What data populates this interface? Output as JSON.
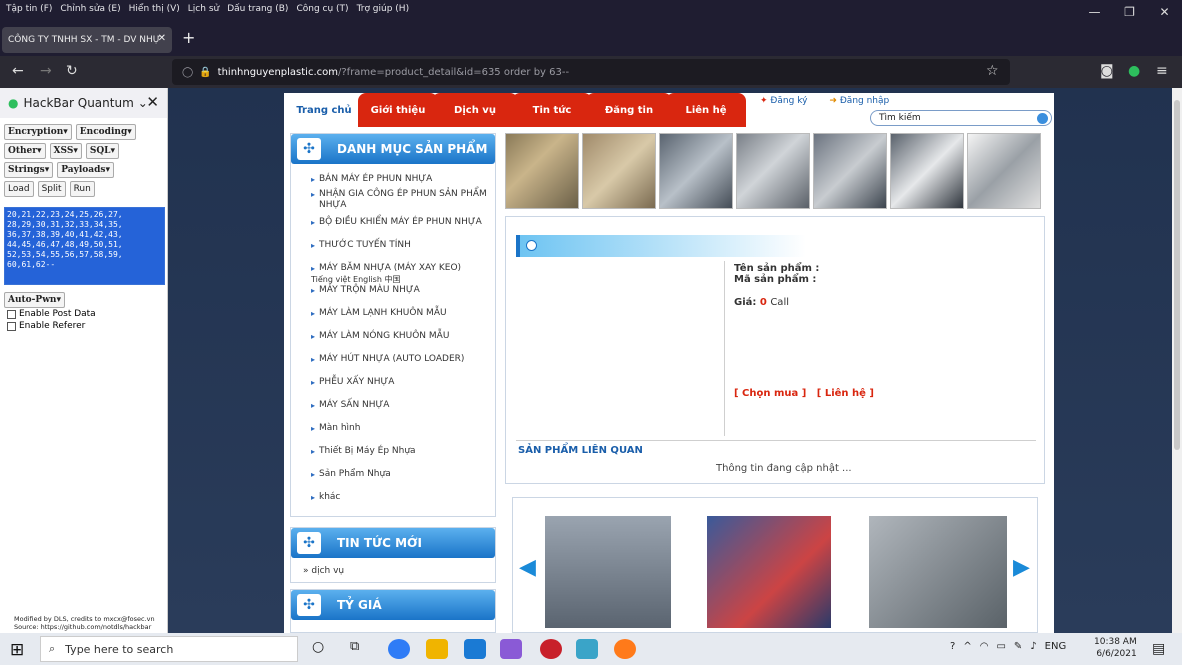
{
  "browser": {
    "menu": [
      "Tập tin (F)",
      "Chỉnh sửa (E)",
      "Hiển thị (V)",
      "Lịch sử",
      "Dấu trang (B)",
      "Công cụ (T)",
      "Trợ giúp (H)"
    ],
    "tab_title": "CÔNG TY TNHH SX - TM - DV NHỰ",
    "url_host": "thinhnguyenplastic.com",
    "url_rest": "/?frame=product_detail&id=635 order by 63--"
  },
  "hackbar": {
    "title": "HackBar Quantum",
    "row1": [
      "Encryption▾",
      "Encoding▾"
    ],
    "row2": [
      "Other▾",
      "XSS▾",
      "SQL▾"
    ],
    "row3": [
      "Strings▾",
      "Payloads▾"
    ],
    "actions": [
      "Load",
      "Split",
      "Run"
    ],
    "text_lines": [
      "20,21,22,23,24,25,26,27,",
      "28,29,30,31,32,33,34,35,",
      "36,37,38,39,40,41,42,43,",
      "44,45,46,47,48,49,50,51,",
      "52,53,54,55,56,57,58,59,",
      "60,61,62--"
    ],
    "autopwn": "Auto-Pwn▾",
    "post": "Enable Post Data",
    "referer": "Enable Referer",
    "footer1": "Modified by DLS, credits to mxcx@fosec.vn",
    "footer2": "Source: https://github.com/notdls/hackbar"
  },
  "site": {
    "nav": [
      "Trang chủ",
      "Giới thiệu",
      "Dịch vụ",
      "Tin tức",
      "Đăng tin",
      "Liên hệ"
    ],
    "register": "Đăng ký",
    "login": "Đăng nhập",
    "search": "Tìm kiếm",
    "cat_title": "DANH MỤC SẢN PHẨM",
    "categories": [
      "BÁN MÁY ÉP PHUN NHỰA",
      "NHẬN GIA CÔNG ÉP PHUN SẢN PHẨM NHỰA",
      "BỘ ĐIỀU KHIỂN MÁY ÉP PHUN NHỰA",
      "THƯỚC TUYẾN TÍNH",
      "MÁY BĂM NHỰA (MÁY XAY KEO)",
      "MÁY TRỘN MÀU NHỰA",
      "MÁY LÀM LẠNH KHUÔN MẪU",
      "MÁY LÀM NÓNG KHUÔN MẪU",
      "MÁY HÚT NHỰA (AUTO LOADER)",
      "PHỄU XẤY NHỰA",
      "MÁY SẤN NHỰA",
      "Màn hình",
      "Thiết Bị Máy Ép Nhựa",
      "Sản Phẩm Nhựa",
      "khác"
    ],
    "langs": "Tiếng việt   English   中国",
    "news_title": "TIN TỨC MỚI",
    "news_item": "dịch vụ",
    "rate_title": "TỶ GIÁ",
    "product_name_label": "Tên sản phẩm :",
    "product_code_label": "Mã sản phẩm :",
    "price_label": "Giá:",
    "price_value": "0",
    "price_unit": "Call",
    "buy": "[ Chọn mua ]",
    "contact": "[ Liên hệ ]",
    "related": "SẢN PHẨM LIÊN QUAN",
    "updating": "Thông tin đang cập nhật ..."
  },
  "taskbar": {
    "search": "Type here to search",
    "lang": "ENG",
    "time": "10:38 AM",
    "date": "6/6/2021"
  }
}
